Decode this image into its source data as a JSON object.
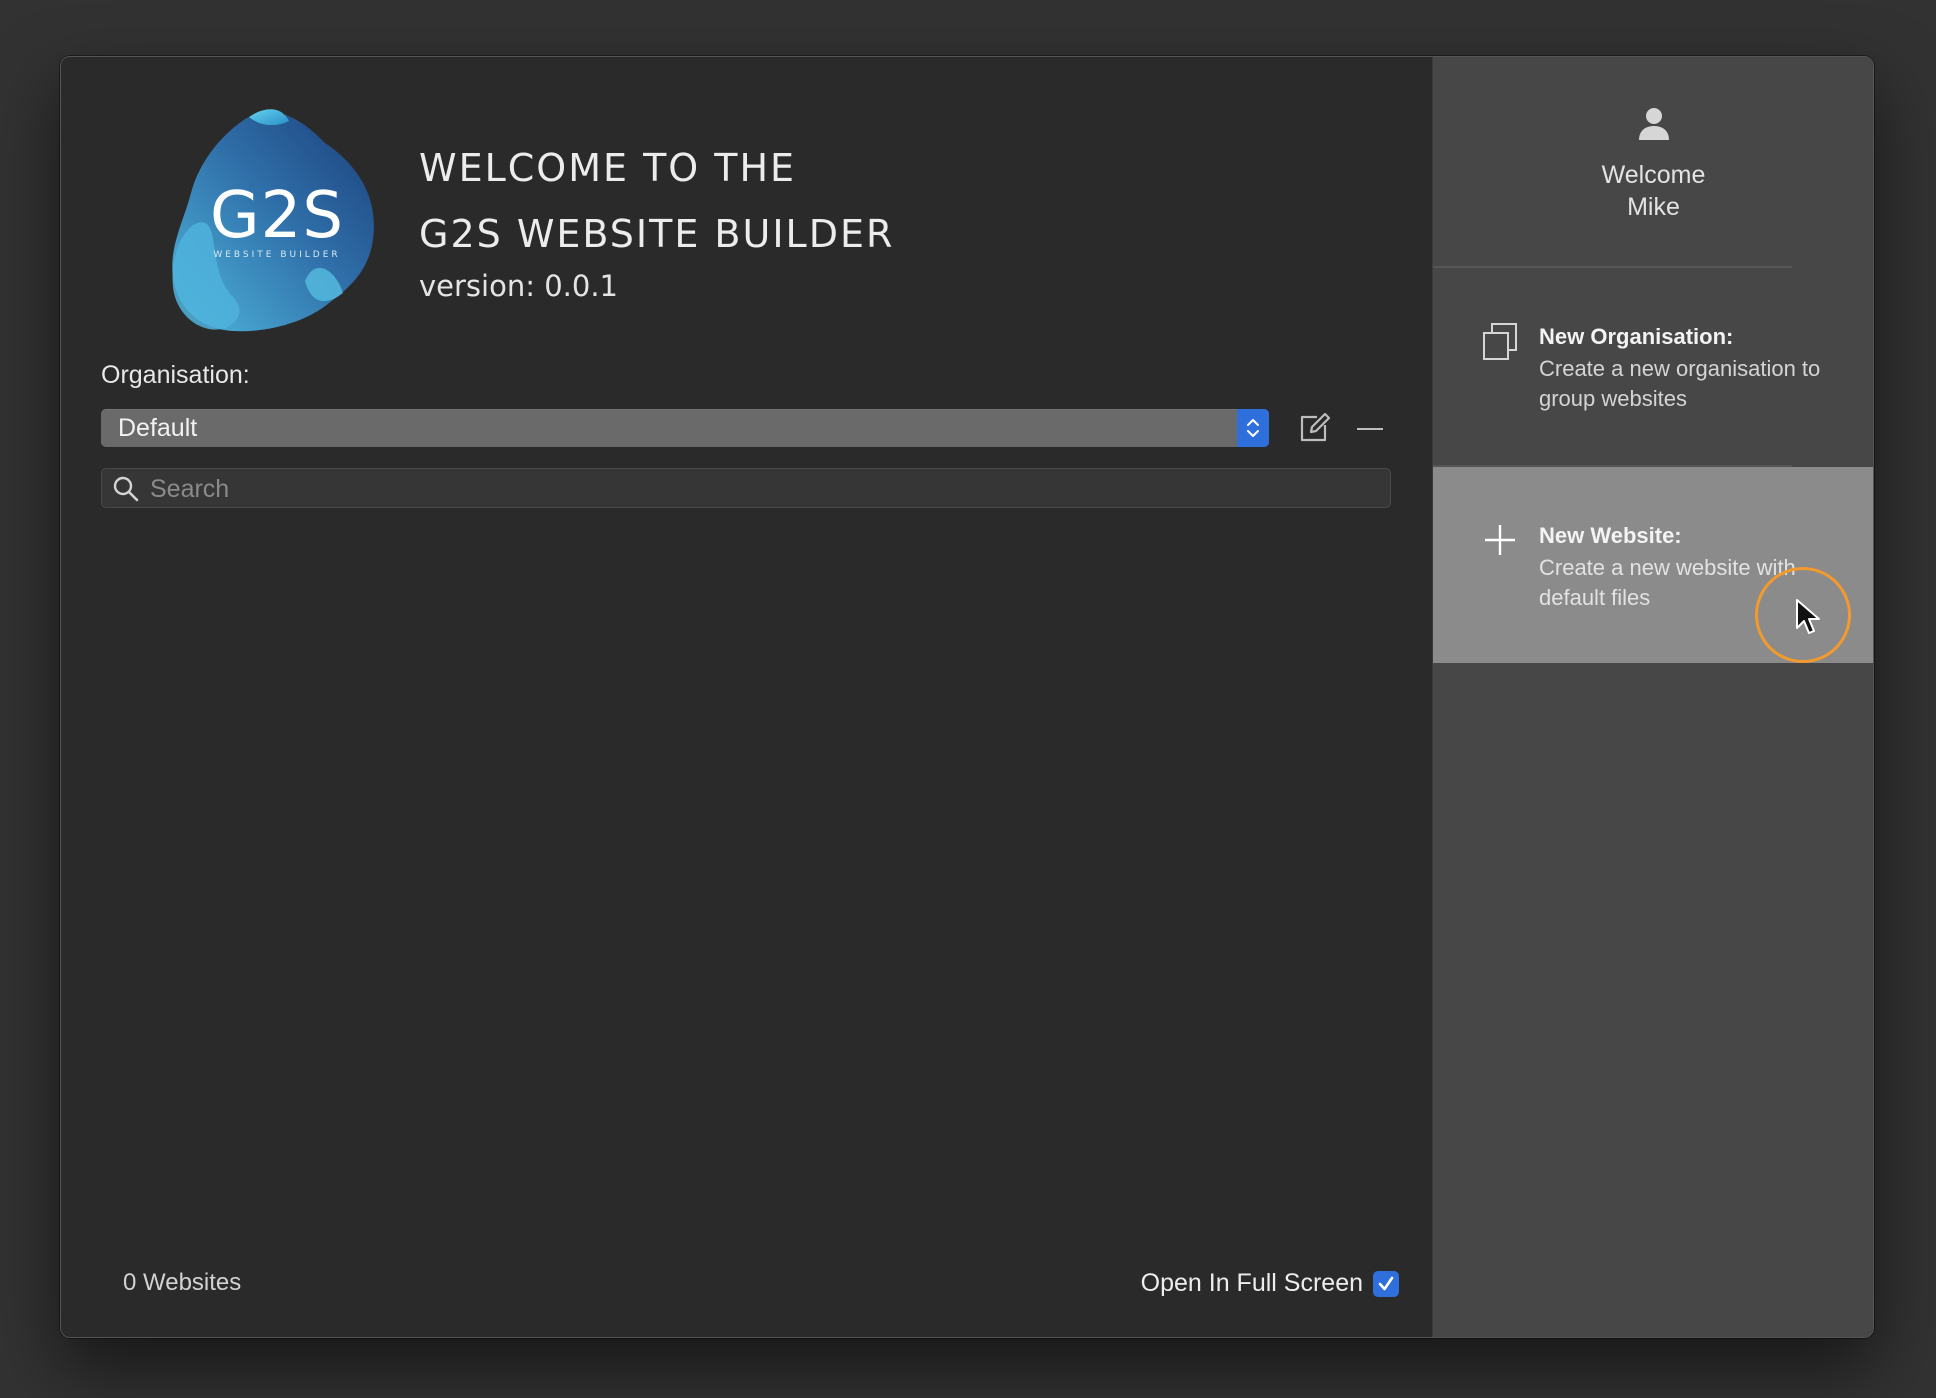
{
  "window": {
    "controls": [
      "close",
      "minimize",
      "zoom"
    ]
  },
  "header": {
    "logo_text": "G2S",
    "logo_subtext": "WEBSITE BUILDER",
    "title_line1": "WELCOME TO THE",
    "title_line2": "G2S WEBSITE BUILDER",
    "version": "version: 0.0.1"
  },
  "organisation": {
    "label": "Organisation:",
    "selected": "Default",
    "edit_icon": "edit-icon",
    "remove_icon": "minus-icon"
  },
  "search": {
    "placeholder": "Search",
    "value": ""
  },
  "footer": {
    "website_count": "0 Websites",
    "fullscreen_label": "Open In Full Screen",
    "fullscreen_checked": true
  },
  "sidebar": {
    "user": {
      "icon": "user-icon",
      "welcome": "Welcome",
      "name": "Mike"
    },
    "actions": [
      {
        "icon": "duplicate-icon",
        "title": "New Organisation:",
        "description": "Create a new organisation to group websites",
        "active": false
      },
      {
        "icon": "plus-icon",
        "title": "New Website:",
        "description": "Create a new website with default files",
        "active": true
      }
    ]
  },
  "colors": {
    "accent": "#2f6fdc",
    "cursor_highlight": "#f29a2e",
    "sidebar_bg": "#474747",
    "sidebar_active_bg": "#8b8b8b",
    "main_bg": "#2a2a2a"
  }
}
